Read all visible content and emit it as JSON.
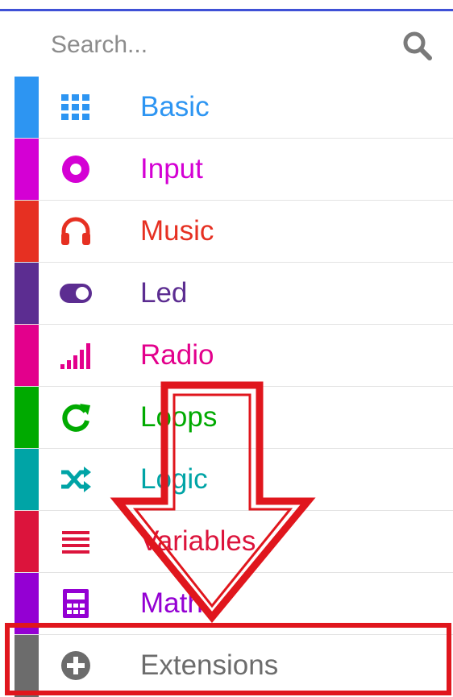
{
  "search": {
    "placeholder": "Search..."
  },
  "categories": [
    {
      "label": "Basic",
      "color": "#2d95f2",
      "icon": "grid-icon"
    },
    {
      "label": "Input",
      "color": "#d400d4",
      "icon": "target-icon"
    },
    {
      "label": "Music",
      "color": "#e63022",
      "icon": "headphones-icon"
    },
    {
      "label": "Led",
      "color": "#5c2d91",
      "icon": "toggle-icon"
    },
    {
      "label": "Radio",
      "color": "#e3008c",
      "icon": "signal-bars-icon"
    },
    {
      "label": "Loops",
      "color": "#00aa00",
      "icon": "refresh-icon"
    },
    {
      "label": "Logic",
      "color": "#00a4a6",
      "icon": "shuffle-icon"
    },
    {
      "label": "Variables",
      "color": "#dc143c",
      "icon": "list-lines-icon"
    },
    {
      "label": "Math",
      "color": "#9400d3",
      "icon": "calculator-icon"
    },
    {
      "label": "Extensions",
      "color": "#6c6c6c",
      "icon": "plus-circle-icon"
    }
  ],
  "annotation": {
    "color": "#e0161d"
  }
}
